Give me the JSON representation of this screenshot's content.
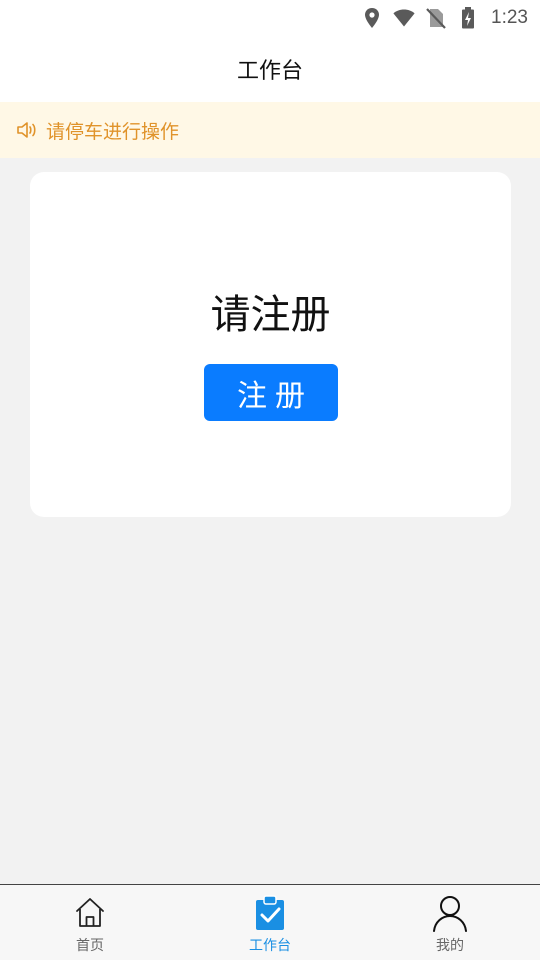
{
  "status_bar": {
    "time": "1:23",
    "icons": [
      "location-icon",
      "wifi-icon",
      "no-sim-icon",
      "battery-charging-icon"
    ]
  },
  "header": {
    "title": "工作台"
  },
  "notice": {
    "icon": "speaker-icon",
    "text": "请停车进行操作",
    "color": "#e0932a"
  },
  "card": {
    "prompt": "请注册",
    "register_button": "注册"
  },
  "tab_bar": {
    "items": [
      {
        "label": "首页",
        "icon": "home-icon",
        "active": false
      },
      {
        "label": "工作台",
        "icon": "clipboard-check-icon",
        "active": true
      },
      {
        "label": "我的",
        "icon": "user-icon",
        "active": false
      }
    ],
    "active_color": "#1a8fe3"
  },
  "colors": {
    "accent": "#0a7cff",
    "background": "#f2f2f2",
    "notice_background": "#fff8e6"
  }
}
